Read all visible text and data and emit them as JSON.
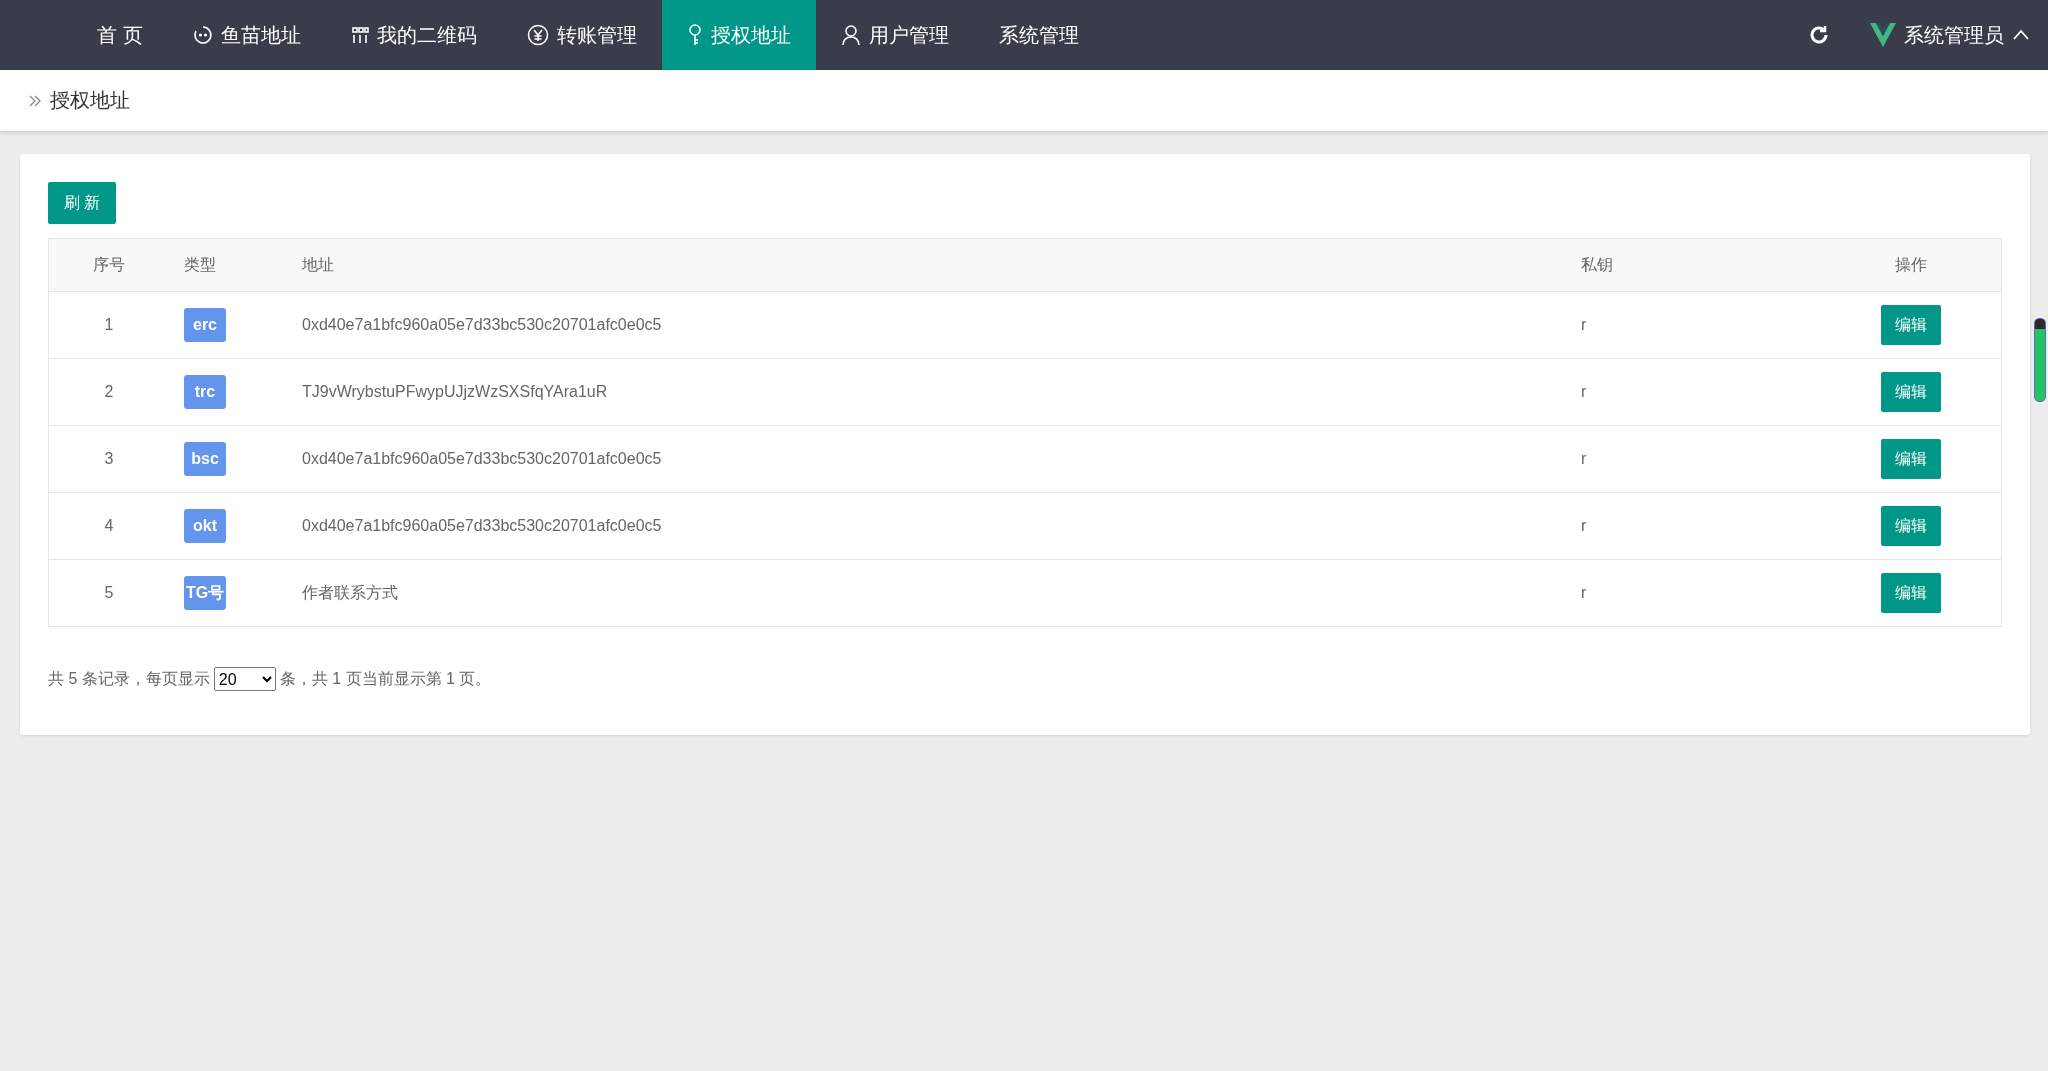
{
  "nav": {
    "items": [
      {
        "label": "首 页",
        "selected": false
      },
      {
        "label": "鱼苗地址",
        "selected": false
      },
      {
        "label": "我的二维码",
        "selected": false
      },
      {
        "label": "转账管理",
        "selected": false
      },
      {
        "label": "授权地址",
        "selected": true
      },
      {
        "label": "用户管理",
        "selected": false
      },
      {
        "label": "系统管理",
        "selected": false
      }
    ],
    "user": "系统管理员"
  },
  "breadcrumb": "授权地址",
  "refresh_button": "刷 新",
  "table": {
    "columns": [
      "序号",
      "类型",
      "地址",
      "私钥",
      "操作"
    ],
    "rows": [
      {
        "index": "1",
        "type": "erc",
        "address": "0xd40e7a1bfc960a05e7d33bc530c20701afc0e0c5",
        "key": "r",
        "action": "编辑"
      },
      {
        "index": "2",
        "type": "trc",
        "address": "TJ9vWrybstuPFwypUJjzWzSXSfqYAra1uR",
        "key": "r",
        "action": "编辑"
      },
      {
        "index": "3",
        "type": "bsc",
        "address": "0xd40e7a1bfc960a05e7d33bc530c20701afc0e0c5",
        "key": "r",
        "action": "编辑"
      },
      {
        "index": "4",
        "type": "okt",
        "address": "0xd40e7a1bfc960a05e7d33bc530c20701afc0e0c5",
        "key": "r",
        "action": "编辑"
      },
      {
        "index": "5",
        "type": "TG号",
        "address": "作者联系方式",
        "key": "r",
        "action": "编辑"
      }
    ]
  },
  "pagination": {
    "before": "共 5 条记录，每页显示",
    "page_size": "20",
    "after": "条，共 1 页当前显示第 1 页。"
  }
}
